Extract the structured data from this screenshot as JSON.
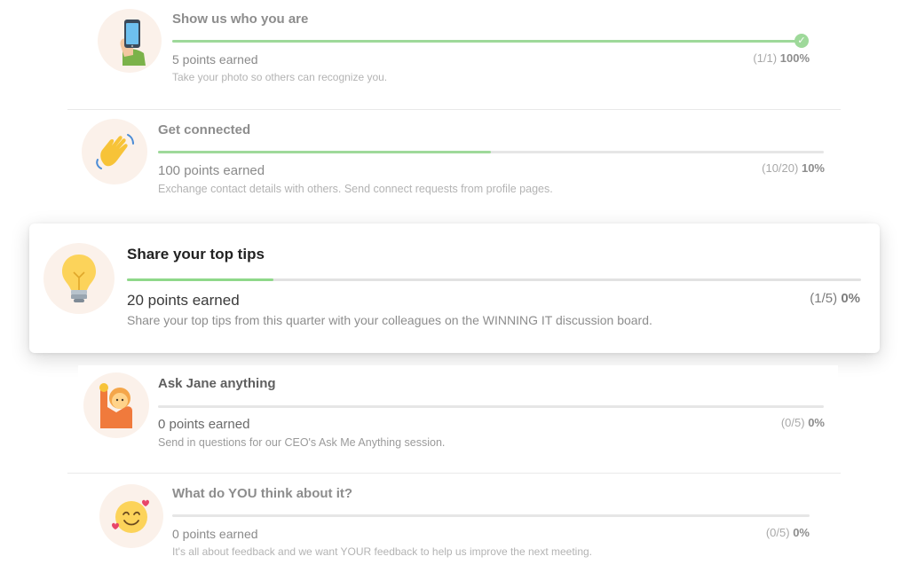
{
  "achievements": [
    {
      "title": "Show us who you are",
      "points": "5 points earned",
      "description": "Take your photo so others can recognize you.",
      "count": "(1/1)",
      "percent": "100%",
      "progress": 1.0,
      "icon": "phone-selfie-icon",
      "completed": true
    },
    {
      "title": "Get connected",
      "points": "100 points earned",
      "description": "Exchange contact details with others. Send connect requests from profile pages.",
      "count": "(10/20)",
      "percent": "10%",
      "progress": 0.5,
      "icon": "waving-hand-icon"
    },
    {
      "title": "Share your top tips",
      "points": "20 points earned",
      "description": "Share your top tips from this quarter with your colleagues on the WINNING IT discussion board.",
      "count": "(1/5)",
      "percent": "0%",
      "progress": 0.2,
      "icon": "lightbulb-icon",
      "active": true
    },
    {
      "title": "Ask Jane anything",
      "points": "0 points earned",
      "description": "Send in questions for our CEO's Ask Me Anything session.",
      "count": "(0/5)",
      "percent": "0%",
      "progress": 0.0,
      "icon": "raising-hand-icon"
    },
    {
      "title": "What do YOU think about it?",
      "points": "0 points earned",
      "description": "It's all about feedback and we want YOUR feedback to help us improve the next meeting.",
      "count": "(0/5)",
      "percent": "0%",
      "progress": 0.0,
      "icon": "smiling-hearts-icon"
    }
  ],
  "colors": {
    "progress_fill": "#9ed99a",
    "track": "#e6e6e6",
    "icon_bg": "#fbf1ea"
  }
}
